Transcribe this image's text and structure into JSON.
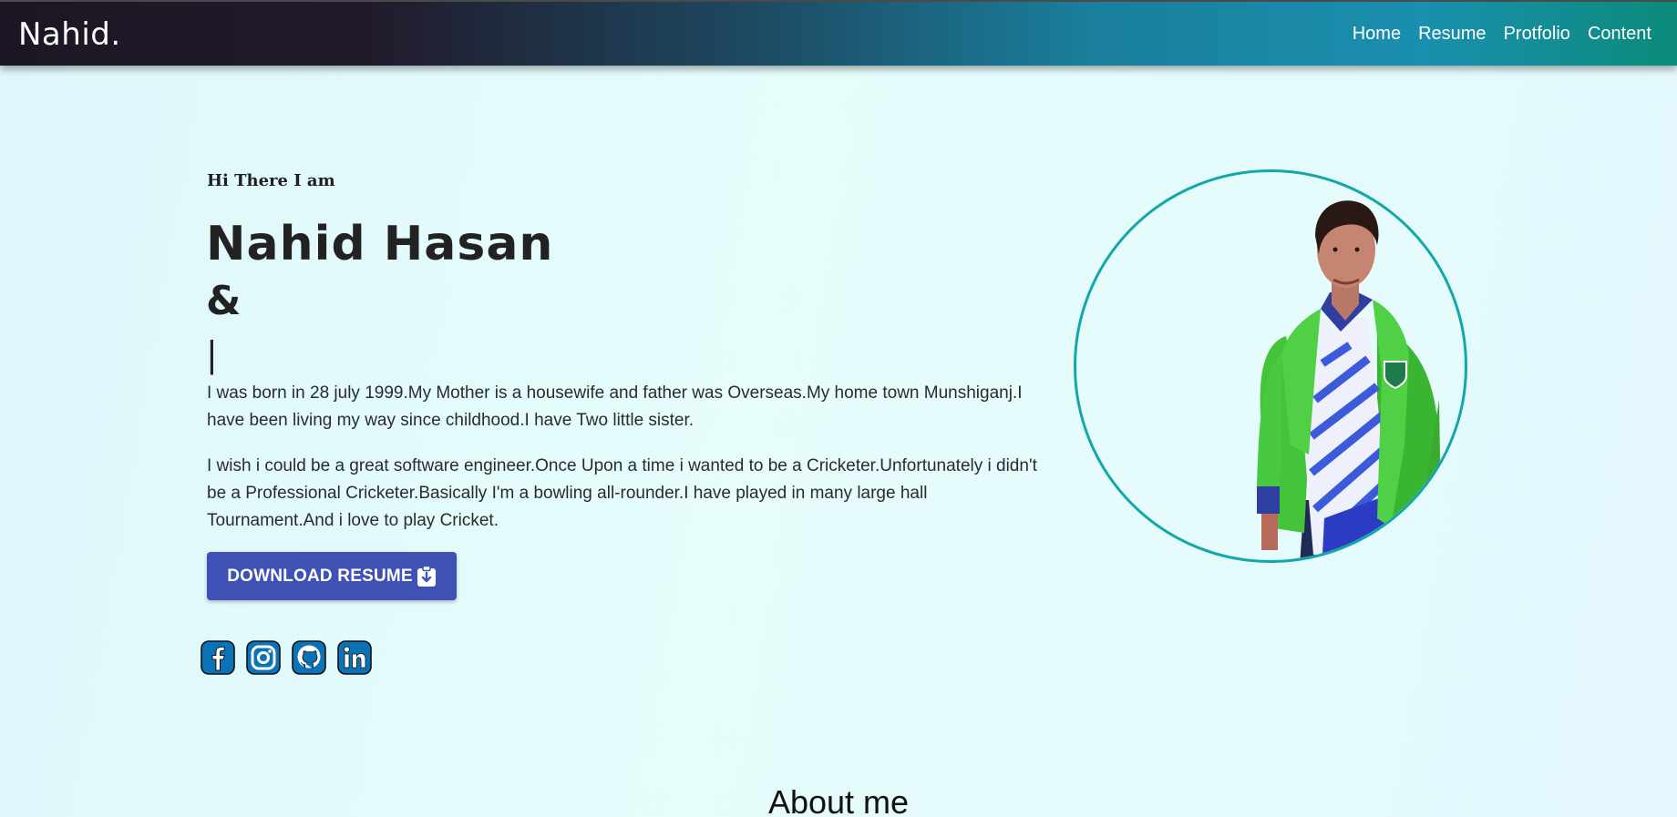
{
  "nav": {
    "brand": "Nahid.",
    "links": [
      "Home",
      "Resume",
      "Protfolio",
      "Content"
    ]
  },
  "hero": {
    "greeting": "Hi There I am",
    "name": "Nahid Hasan",
    "amp": "&",
    "cursor": "|",
    "bio1": "I was born in 28 july 1999.My Mother is a housewife and father was Overseas.My home town Munshiganj.I have been living my way since childhood.I have Two little sister.",
    "bio2": "I wish i could be a great software engineer.Once Upon a time i wanted to be a Cricketer.Unfortunately i didn't be a Professional Cricketer.Basically I'm a bowling all-rounder.I have played in many large hall Tournament.And i love to play Cricket.",
    "download_label": "DOWNLOAD RESUME"
  },
  "socials": [
    "facebook-icon",
    "instagram-icon",
    "github-icon",
    "linkedin-icon"
  ],
  "about": {
    "heading": "About me"
  },
  "colors": {
    "accent": "#3f51b5",
    "ring": "#14a7a9",
    "social": "#0a73b7"
  }
}
